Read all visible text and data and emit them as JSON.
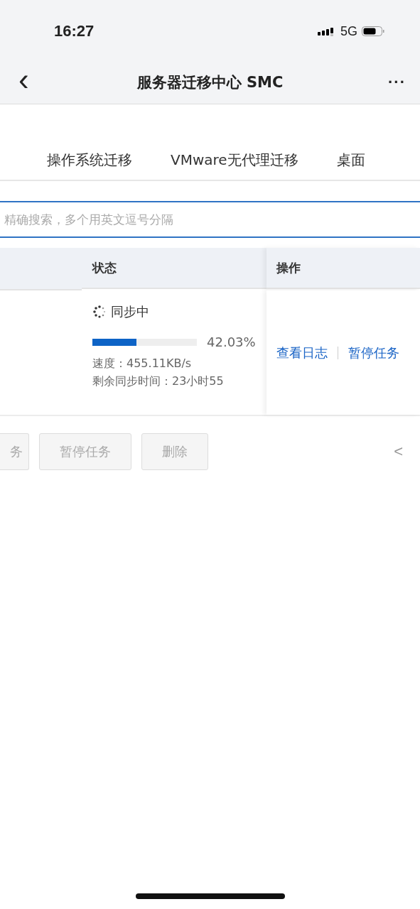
{
  "status_bar": {
    "time": "16:27",
    "network": "5G"
  },
  "nav": {
    "back": "‹",
    "title": "服务器迁移中心 SMC",
    "more": "···"
  },
  "tabs": [
    {
      "label": "操作系统迁移",
      "selected": false
    },
    {
      "label": "VMware无代理迁移",
      "selected": false
    },
    {
      "label": "桌面",
      "selected": false
    }
  ],
  "search": {
    "placeholder": "精确搜索，多个用英文逗号分隔"
  },
  "table": {
    "columns": [
      "状态",
      "操作"
    ],
    "rows": [
      {
        "status": "同步中",
        "level": 0.4203,
        "percent": "42.03%",
        "speed": "速度：455.11KB/s",
        "remaining": "剩余同步时间：23小时55",
        "actions": [
          "查看日志",
          "暂停任务"
        ]
      }
    ]
  },
  "buttons": [
    {
      "label": "务",
      "disabled": true
    },
    {
      "label": "暂停任务",
      "disabled": true
    },
    {
      "label": "删除",
      "disabled": true
    }
  ],
  "pager": {
    "prev": "<"
  }
}
